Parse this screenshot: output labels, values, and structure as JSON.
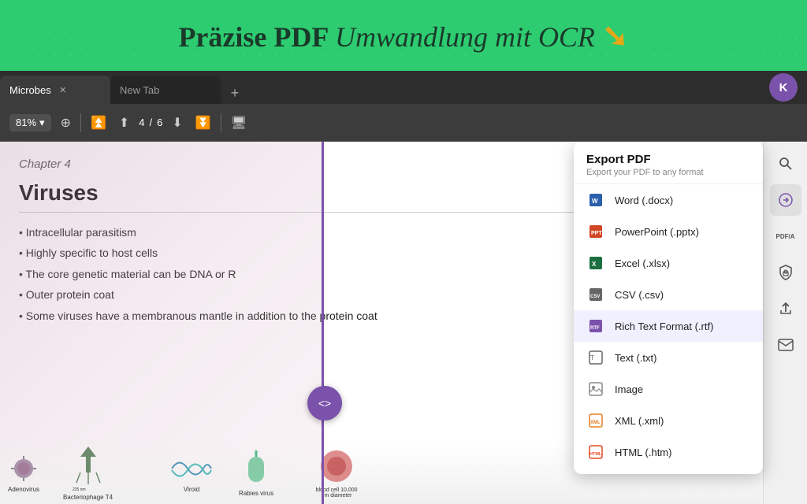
{
  "banner": {
    "text_regular": "Präzise PDF ",
    "text_italic": "Umwandlung mit OCR",
    "arrow": "➘"
  },
  "tabs": [
    {
      "label": "Microbes",
      "active": true
    },
    {
      "label": "New Tab",
      "active": false
    }
  ],
  "tab_new_label": "+",
  "avatar_letter": "K",
  "toolbar": {
    "zoom": "81%",
    "page_current": "4",
    "page_total": "6"
  },
  "pdf": {
    "chapter": "Chapter 4",
    "title": "Viruses",
    "bullets": [
      "Intracellular parasitism",
      "Highly specific to host cells",
      "The core genetic material can be DNA or R",
      "Outer protein coat",
      "Some viruses have a membranous mantle in addition to the protein coat"
    ],
    "illustrations": [
      {
        "label": "Adenovirus"
      },
      {
        "label": "Bacteriophage T4"
      },
      {
        "label": "Viroid"
      },
      {
        "label": "Rabies virus"
      },
      {
        "label": "blood cell 10,000 um diameter"
      }
    ]
  },
  "export_panel": {
    "title": "Export PDF",
    "subtitle": "Export your PDF to any format",
    "items": [
      {
        "label": "Word (.docx)",
        "icon_type": "word"
      },
      {
        "label": "PowerPoint (.pptx)",
        "icon_type": "ppt"
      },
      {
        "label": "Excel (.xlsx)",
        "icon_type": "excel"
      },
      {
        "label": "CSV (.csv)",
        "icon_type": "csv"
      },
      {
        "label": "Rich Text Format (.rtf)",
        "icon_type": "rtf",
        "highlighted": true
      },
      {
        "label": "Text (.txt)",
        "icon_type": "txt"
      },
      {
        "label": "Image",
        "icon_type": "img"
      },
      {
        "label": "XML (.xml)",
        "icon_type": "xml"
      },
      {
        "label": "HTML (.htm)",
        "icon_type": "html"
      }
    ]
  },
  "sidebar_buttons": [
    {
      "icon": "🔍",
      "label": "search",
      "name": "search-button"
    },
    {
      "icon": "🔄",
      "label": "convert",
      "name": "convert-button",
      "active": true
    },
    {
      "icon": "PDF/A",
      "label": "PDF/A",
      "name": "pdfa-button",
      "is_text": true
    },
    {
      "icon": "🔒",
      "label": "protect",
      "name": "protect-button"
    },
    {
      "icon": "⬆",
      "label": "share",
      "name": "share-button"
    },
    {
      "icon": "✉",
      "label": "email",
      "name": "email-button"
    }
  ]
}
